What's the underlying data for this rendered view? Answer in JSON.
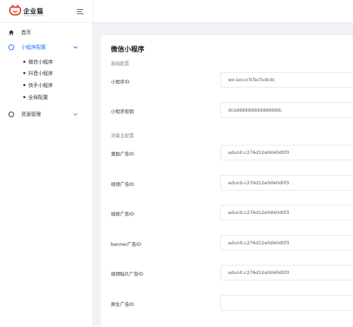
{
  "brand": {
    "name": "企业猫",
    "tagline": "www.qiyemao.com",
    "accent": "#e8483b",
    "primary": "#1e6fff"
  },
  "sidebar": {
    "items": [
      {
        "label": "首页",
        "icon": "home-icon"
      },
      {
        "label": "小程序配置",
        "icon": "circle-icon",
        "active": true,
        "children": [
          "微信小程序",
          "抖音小程序",
          "快手小程序",
          "全局配置"
        ]
      },
      {
        "label": "资源管理",
        "icon": "circle-icon"
      }
    ]
  },
  "main": {
    "title": "微信小程序",
    "sections": {
      "basic": "基础配置",
      "traffic": "流量主配置"
    },
    "fields": [
      {
        "label": "小程序ID",
        "value": "wx-sxcccfcfecfvdcdc"
      },
      {
        "label": "小程序密钥",
        "value": "dcsdddddddddddddddc"
      },
      {
        "label": "激励广告ID",
        "value": "adunit-c276d12e0d40d0f3"
      },
      {
        "label": "视频广告ID",
        "value": "adunit-c276d12e0d40d0f3"
      },
      {
        "label": "插屏广告ID",
        "value": "adunit-c276d12e0d40d0f3"
      },
      {
        "label": "banner广告ID",
        "value": "adunit-c276d12e0d40d0f3"
      },
      {
        "label": "视频贴片广告ID",
        "value": "adunit-c276d12e0d40d0f3"
      },
      {
        "label": "原生广告ID",
        "value": ""
      }
    ]
  }
}
